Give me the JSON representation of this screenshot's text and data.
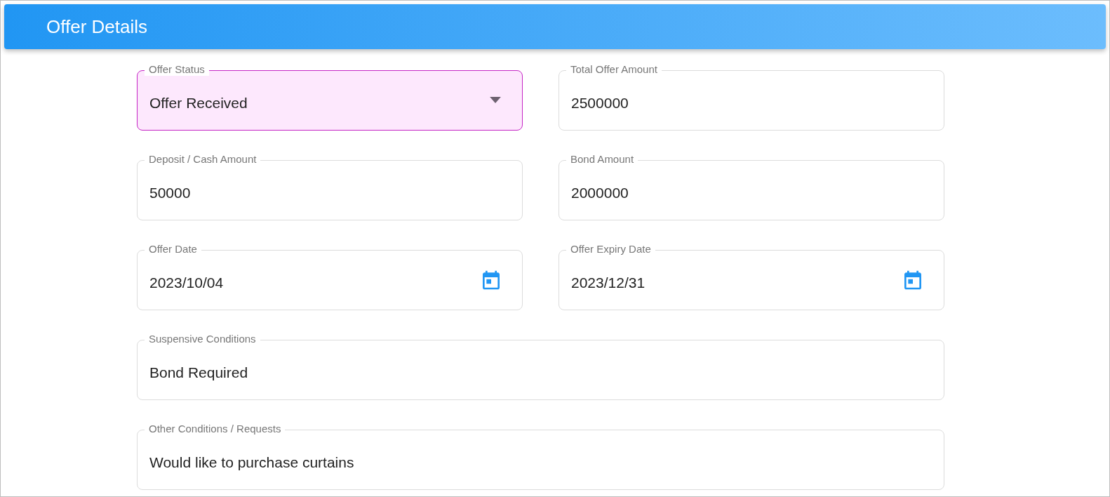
{
  "header": {
    "title": "Offer Details"
  },
  "rows": [
    {
      "fields": [
        {
          "label": "Offer Status",
          "value": "Offer Received",
          "kind": "select",
          "highlighted": true
        },
        {
          "label": "Total Offer Amount",
          "value": "2500000",
          "kind": "text",
          "highlighted": false
        }
      ]
    },
    {
      "fields": [
        {
          "label": "Deposit / Cash Amount",
          "value": "50000",
          "kind": "text",
          "highlighted": false
        },
        {
          "label": "Bond Amount",
          "value": "2000000",
          "kind": "text",
          "highlighted": false
        }
      ]
    },
    {
      "fields": [
        {
          "label": "Offer Date",
          "value": "2023/10/04",
          "kind": "date",
          "highlighted": false
        },
        {
          "label": "Offer Expiry Date",
          "value": "2023/12/31",
          "kind": "date",
          "highlighted": false
        }
      ]
    },
    {
      "fields": [
        {
          "label": "Suspensive Conditions",
          "value": "Bond Required",
          "kind": "text",
          "highlighted": false
        }
      ]
    },
    {
      "fields": [
        {
          "label": "Other Conditions / Requests",
          "value": "Would like to purchase curtains",
          "kind": "text",
          "highlighted": false
        }
      ]
    }
  ]
}
